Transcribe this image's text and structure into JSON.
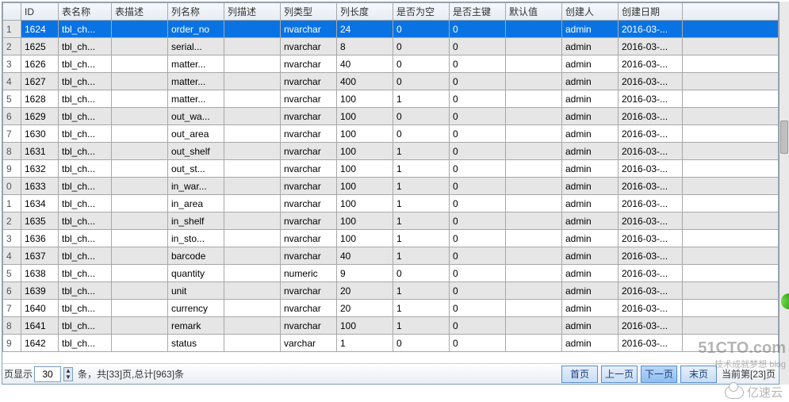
{
  "columns": {
    "id": "ID",
    "tableName": "表名称",
    "tableDesc": "表描述",
    "colName": "列名称",
    "colDesc": "列描述",
    "colType": "列类型",
    "colLen": "列长度",
    "isNull": "是否为空",
    "isPk": "是否主键",
    "default": "默认值",
    "creator": "创建人",
    "createDate": "创建日期"
  },
  "rows": [
    {
      "n": "1",
      "id": "1624",
      "tbl": "tbl_ch...",
      "tdesc": "",
      "cname": "order_no",
      "cdesc": "",
      "ctype": "nvarchar",
      "clen": "24",
      "null": "0",
      "pk": "0",
      "def": "",
      "cr": "admin",
      "cd": "2016-03-..."
    },
    {
      "n": "2",
      "id": "1625",
      "tbl": "tbl_ch...",
      "tdesc": "",
      "cname": "serial...",
      "cdesc": "",
      "ctype": "nvarchar",
      "clen": "8",
      "null": "0",
      "pk": "0",
      "def": "",
      "cr": "admin",
      "cd": "2016-03-..."
    },
    {
      "n": "3",
      "id": "1626",
      "tbl": "tbl_ch...",
      "tdesc": "",
      "cname": "matter...",
      "cdesc": "",
      "ctype": "nvarchar",
      "clen": "40",
      "null": "0",
      "pk": "0",
      "def": "",
      "cr": "admin",
      "cd": "2016-03-..."
    },
    {
      "n": "4",
      "id": "1627",
      "tbl": "tbl_ch...",
      "tdesc": "",
      "cname": "matter...",
      "cdesc": "",
      "ctype": "nvarchar",
      "clen": "400",
      "null": "0",
      "pk": "0",
      "def": "",
      "cr": "admin",
      "cd": "2016-03-..."
    },
    {
      "n": "5",
      "id": "1628",
      "tbl": "tbl_ch...",
      "tdesc": "",
      "cname": "matter...",
      "cdesc": "",
      "ctype": "nvarchar",
      "clen": "100",
      "null": "1",
      "pk": "0",
      "def": "",
      "cr": "admin",
      "cd": "2016-03-..."
    },
    {
      "n": "6",
      "id": "1629",
      "tbl": "tbl_ch...",
      "tdesc": "",
      "cname": "out_wa...",
      "cdesc": "",
      "ctype": "nvarchar",
      "clen": "100",
      "null": "0",
      "pk": "0",
      "def": "",
      "cr": "admin",
      "cd": "2016-03-..."
    },
    {
      "n": "7",
      "id": "1630",
      "tbl": "tbl_ch...",
      "tdesc": "",
      "cname": "out_area",
      "cdesc": "",
      "ctype": "nvarchar",
      "clen": "100",
      "null": "0",
      "pk": "0",
      "def": "",
      "cr": "admin",
      "cd": "2016-03-..."
    },
    {
      "n": "8",
      "id": "1631",
      "tbl": "tbl_ch...",
      "tdesc": "",
      "cname": "out_shelf",
      "cdesc": "",
      "ctype": "nvarchar",
      "clen": "100",
      "null": "1",
      "pk": "0",
      "def": "",
      "cr": "admin",
      "cd": "2016-03-..."
    },
    {
      "n": "9",
      "id": "1632",
      "tbl": "tbl_ch...",
      "tdesc": "",
      "cname": "out_st...",
      "cdesc": "",
      "ctype": "nvarchar",
      "clen": "100",
      "null": "1",
      "pk": "0",
      "def": "",
      "cr": "admin",
      "cd": "2016-03-..."
    },
    {
      "n": "0",
      "id": "1633",
      "tbl": "tbl_ch...",
      "tdesc": "",
      "cname": "in_war...",
      "cdesc": "",
      "ctype": "nvarchar",
      "clen": "100",
      "null": "1",
      "pk": "0",
      "def": "",
      "cr": "admin",
      "cd": "2016-03-..."
    },
    {
      "n": "1",
      "id": "1634",
      "tbl": "tbl_ch...",
      "tdesc": "",
      "cname": "in_area",
      "cdesc": "",
      "ctype": "nvarchar",
      "clen": "100",
      "null": "1",
      "pk": "0",
      "def": "",
      "cr": "admin",
      "cd": "2016-03-..."
    },
    {
      "n": "2",
      "id": "1635",
      "tbl": "tbl_ch...",
      "tdesc": "",
      "cname": "in_shelf",
      "cdesc": "",
      "ctype": "nvarchar",
      "clen": "100",
      "null": "1",
      "pk": "0",
      "def": "",
      "cr": "admin",
      "cd": "2016-03-..."
    },
    {
      "n": "3",
      "id": "1636",
      "tbl": "tbl_ch...",
      "tdesc": "",
      "cname": "in_sto...",
      "cdesc": "",
      "ctype": "nvarchar",
      "clen": "100",
      "null": "1",
      "pk": "0",
      "def": "",
      "cr": "admin",
      "cd": "2016-03-..."
    },
    {
      "n": "4",
      "id": "1637",
      "tbl": "tbl_ch...",
      "tdesc": "",
      "cname": "barcode",
      "cdesc": "",
      "ctype": "nvarchar",
      "clen": "40",
      "null": "1",
      "pk": "0",
      "def": "",
      "cr": "admin",
      "cd": "2016-03-..."
    },
    {
      "n": "5",
      "id": "1638",
      "tbl": "tbl_ch...",
      "tdesc": "",
      "cname": "quantity",
      "cdesc": "",
      "ctype": "numeric",
      "clen": "9",
      "null": "0",
      "pk": "0",
      "def": "",
      "cr": "admin",
      "cd": "2016-03-..."
    },
    {
      "n": "6",
      "id": "1639",
      "tbl": "tbl_ch...",
      "tdesc": "",
      "cname": "unit",
      "cdesc": "",
      "ctype": "nvarchar",
      "clen": "20",
      "null": "1",
      "pk": "0",
      "def": "",
      "cr": "admin",
      "cd": "2016-03-..."
    },
    {
      "n": "7",
      "id": "1640",
      "tbl": "tbl_ch...",
      "tdesc": "",
      "cname": "currency",
      "cdesc": "",
      "ctype": "nvarchar",
      "clen": "20",
      "null": "1",
      "pk": "0",
      "def": "",
      "cr": "admin",
      "cd": "2016-03-..."
    },
    {
      "n": "8",
      "id": "1641",
      "tbl": "tbl_ch...",
      "tdesc": "",
      "cname": "remark",
      "cdesc": "",
      "ctype": "nvarchar",
      "clen": "100",
      "null": "1",
      "pk": "0",
      "def": "",
      "cr": "admin",
      "cd": "2016-03-..."
    },
    {
      "n": "9",
      "id": "1642",
      "tbl": "tbl_ch...",
      "tdesc": "",
      "cname": "status",
      "cdesc": "",
      "ctype": "varchar",
      "clen": "1",
      "null": "0",
      "pk": "0",
      "def": "",
      "cr": "admin",
      "cd": "2016-03-..."
    }
  ],
  "pager": {
    "prefix": "页显示",
    "pageSize": "30",
    "summary": "条，共[33]页,总计[963]条",
    "first": "首页",
    "prev": "上一页",
    "next": "下一页",
    "last": "末页",
    "position": "当前第[23]页"
  },
  "watermarks": {
    "cto": "51CTO.com",
    "ctoSub": "技术成就梦想 blog",
    "ysy": "亿速云"
  }
}
